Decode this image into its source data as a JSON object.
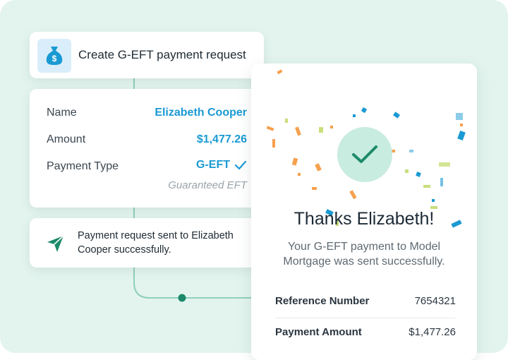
{
  "request_card": {
    "title": "Create G-EFT payment request",
    "icon": "money-bag-icon"
  },
  "details": {
    "name_label": "Name",
    "name_value": "Elizabeth Cooper",
    "amount_label": "Amount",
    "amount_value": "$1,477.26",
    "type_label": "Payment Type",
    "type_value": "G-EFT",
    "type_sub": "Guaranteed EFT"
  },
  "sent_card": {
    "message": "Payment request sent to Elizabeth Cooper successfully.",
    "icon": "send-icon"
  },
  "confirmation": {
    "title": "Thanks Elizabeth!",
    "subtitle": "Your G-EFT payment to Model Mortgage was sent successfully.",
    "reference_label": "Reference Number",
    "reference_value": "7654321",
    "amount_label": "Payment Amount",
    "amount_value": "$1,477.26",
    "icon": "check-circle-icon"
  },
  "colors": {
    "accent_blue": "#1a9ad3",
    "accent_green": "#1c8a6a",
    "background": "#e3f4ee"
  }
}
